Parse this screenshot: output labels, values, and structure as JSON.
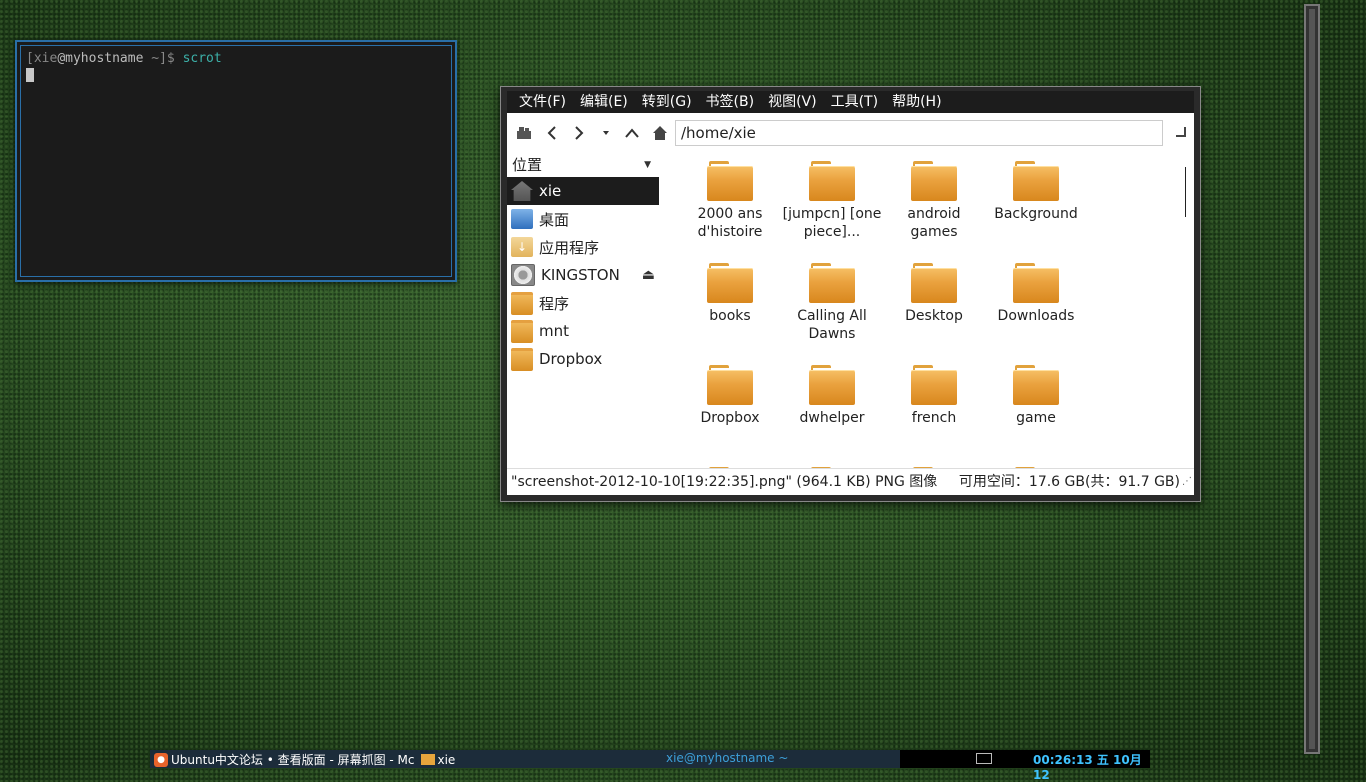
{
  "terminal": {
    "prompt_open": "[",
    "user": "xie",
    "at": "@",
    "host": "myhostname",
    "dir": " ~]$ ",
    "command": "scrot"
  },
  "file_manager": {
    "menus": [
      "文件(F)",
      "编辑(E)",
      "转到(G)",
      "书签(B)",
      "视图(V)",
      "工具(T)",
      "帮助(H)"
    ],
    "path": "/home/xie",
    "sidebar_header": "位置",
    "places": [
      {
        "label": "xie",
        "icon": "home-icon",
        "selected": true
      },
      {
        "label": "桌面",
        "icon": "desktop-icon"
      },
      {
        "label": "应用程序",
        "icon": "applications-icon"
      },
      {
        "label": "KINGSTON",
        "icon": "drive-icon",
        "eject": true
      },
      {
        "label": "程序",
        "icon": "folder-icon"
      },
      {
        "label": "mnt",
        "icon": "folder-icon"
      },
      {
        "label": "Dropbox",
        "icon": "folder-icon"
      }
    ],
    "folders": [
      "2000 ans d'histoire",
      "[jumpcn] [one piece]...",
      "android games",
      "Background",
      "books",
      "Calling All Dawns",
      "Desktop",
      "Downloads",
      "Dropbox",
      "dwhelper",
      "french",
      "game"
    ],
    "status_left": "\"screenshot-2012-10-10[19:22:35].png\" (964.1 KB) PNG 图像",
    "status_right": "可用空间：17.6 GB(共：91.7 GB)"
  },
  "taskbar": {
    "task1_label": "Ubuntu中文论坛 • 查看版面 - 屏幕抓图 - Mc",
    "task2_label": "xie",
    "center_title": "xie@myhostname ~",
    "clock": "00:26:13 五 10月12"
  }
}
